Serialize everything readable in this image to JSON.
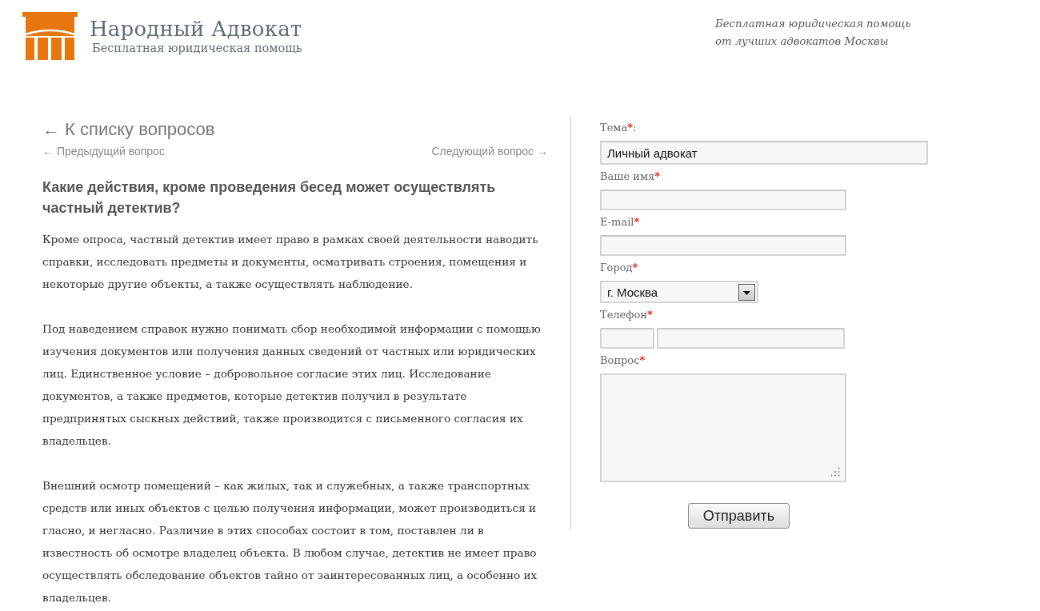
{
  "header": {
    "logo": {
      "title": "Народный Адвокат",
      "subtitle": "Бесплатная юридическая помощь"
    },
    "tagline_lines": [
      "Бесплатная юридическая помощь",
      "от лучших адвокатов Москвы"
    ]
  },
  "navigation": {
    "back_link": "← К списку вопросов",
    "previous_link": "← Предыдущий вопрос",
    "next_link": "Следующий вопрос →"
  },
  "article": {
    "title": "Какие действия, кроме проведения бесед может осуществлять частный детектив?",
    "paragraphs": [
      "Кроме опроса, частный детектив имеет право в рамках своей деятельности наводить справки, исследовать предметы и документы, осматривать строения, помещения и некоторые другие объекты, а также осуществлять наблюдение.",
      "Под наведением справок нужно понимать сбор необходимой информации с помощью изучения документов или получения данных сведений от частных или юридических лиц. Единственное условие – добровольное согласие этих лиц. Исследование документов, а также предметов, которые детектив получил в результате предпринятых сыскных действий, также производится с письменного согласия их владельцев.",
      "Внешний осмотр помещений – как жилых, так и служебных, а также транспортных средств или иных объектов с целью получения информации, может производиться и гласно, и негласно. Различие в этих способах состоит в том, поставлен ли в известность об осмотре владелец объекта. В любом случае, детектив не имеет право осуществлять обследование объектов тайно от заинтересованных лиц, а особенно их владельцев."
    ]
  },
  "form": {
    "fields": [
      {
        "kind": "wide",
        "label": "Тема",
        "mark": "*",
        "label_end": ":",
        "value": "Личный адвокат"
      },
      {
        "kind": "text",
        "label": "Ваше имя",
        "mark": "*"
      },
      {
        "kind": "text",
        "label": "E-mail",
        "mark": "*"
      },
      {
        "kind": "select",
        "label": "Город",
        "mark": "*",
        "value": "г. Москва"
      },
      {
        "kind": "phone",
        "label": "Телефон",
        "mark": "*"
      },
      {
        "kind": "textarea",
        "label": "Вопрос",
        "mark": "*"
      }
    ],
    "submit": "Отправить"
  }
}
